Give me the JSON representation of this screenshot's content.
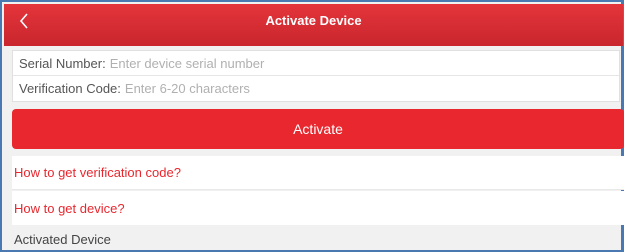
{
  "header": {
    "title": "Activate Device",
    "back_icon": "chevron-left-icon"
  },
  "form": {
    "serial_label": "Serial Number:",
    "serial_placeholder": "Enter device serial number",
    "verification_label": "Verification Code:",
    "verification_placeholder": "Enter 6-20 characters"
  },
  "activate_button_label": "Activate",
  "links": {
    "verification_help": "How to get verification code?",
    "device_help": "How to get device?"
  },
  "activated_section_label": "Activated Device",
  "colors": {
    "accent": "#e8272e",
    "header": "#d52c33",
    "window_border": "#4a78b0"
  }
}
